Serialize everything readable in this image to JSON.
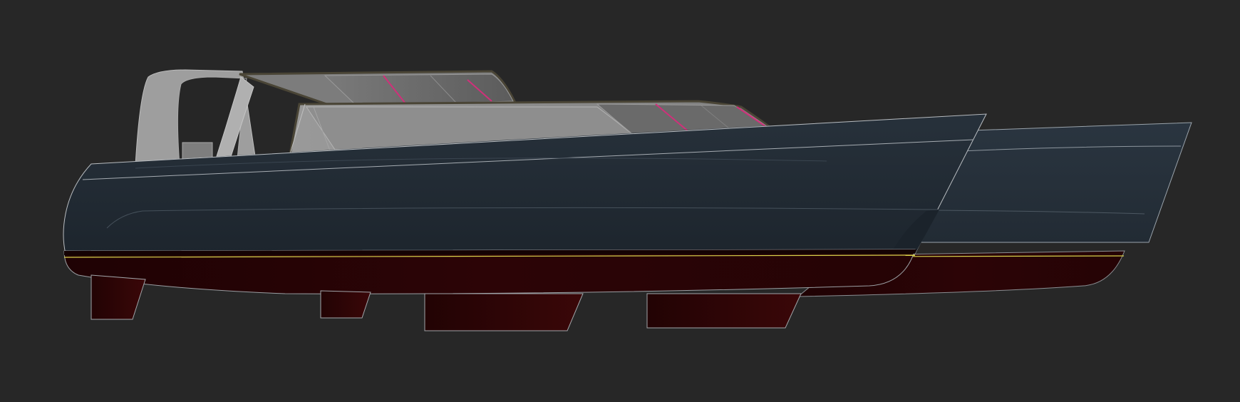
{
  "scene": {
    "subject": "catamaran-side-elevation-render",
    "colors": {
      "background": "#272727",
      "hull_topside": "#222b33",
      "hull_topside_far": "#26303a",
      "antifouling": "#2a0406",
      "antifouling_light": "#3a0a0c",
      "superstructure": "#8a8a8a",
      "superstructure_light": "#a4a4a4",
      "glazing": "#6e6e6e",
      "canopy_frame": "#4a4536",
      "waterline": "#d8d24a",
      "edge_lines": "#b8bcc0",
      "mullion_accent": "#d0307a"
    }
  }
}
